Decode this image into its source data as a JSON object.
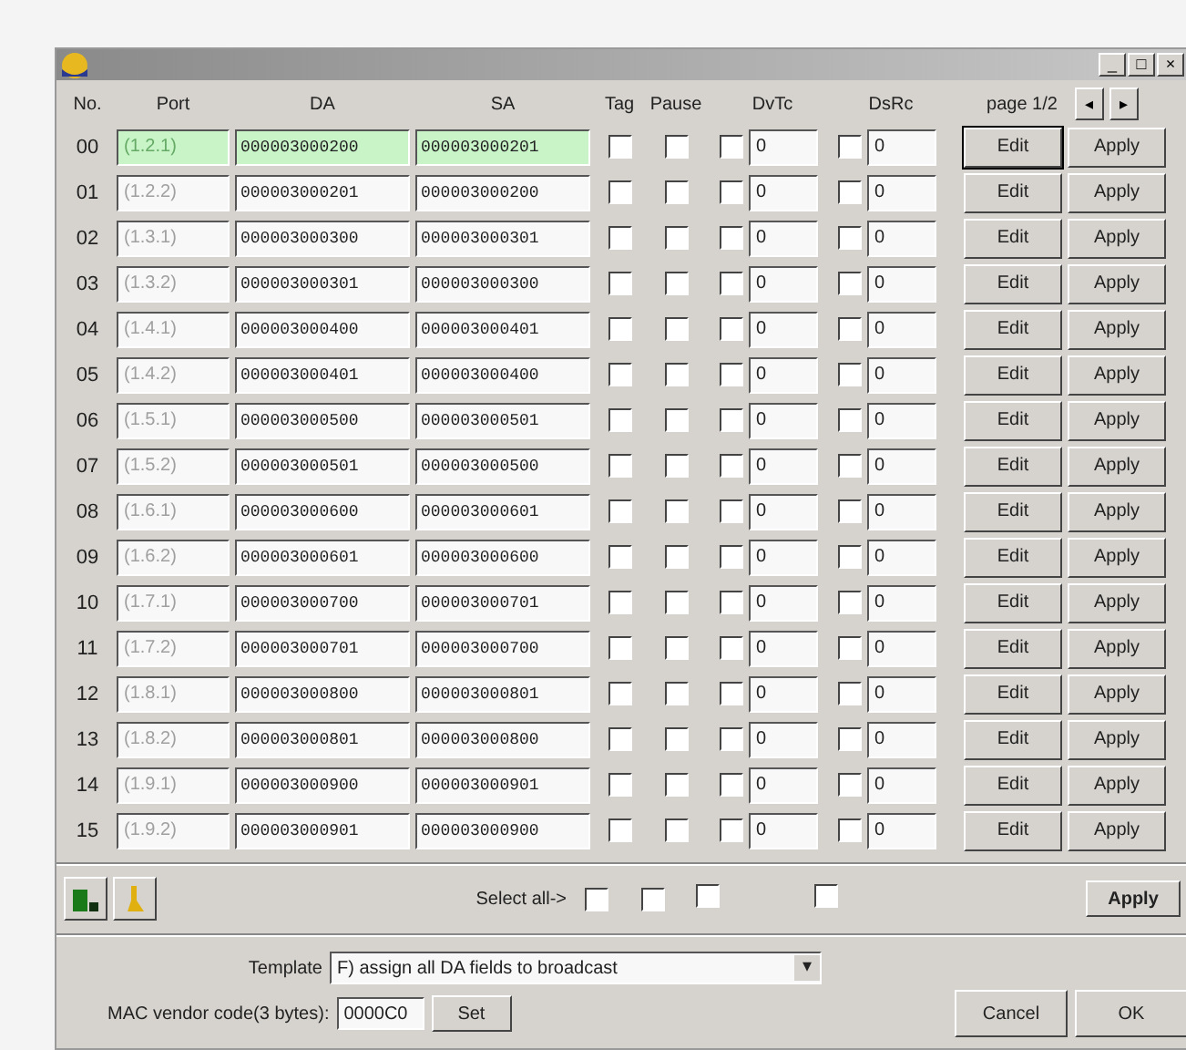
{
  "window": {
    "buttons": [
      "_",
      "□",
      "×"
    ]
  },
  "header": {
    "columns": [
      "No.",
      "Port",
      "DA",
      "SA",
      "Tag",
      "Pause",
      "DvTc",
      "DsRc"
    ],
    "page": "page 1/2",
    "nav": [
      "◂",
      "▸"
    ]
  },
  "rows": [
    {
      "no": "00",
      "port": "(1.2.1)",
      "da": "000003000200",
      "sa": "000003000201",
      "tag": false,
      "pause": false,
      "dv_checked": false,
      "dv": "0",
      "ds_checked": false,
      "ds": "0",
      "selected": true,
      "edit": "Edit",
      "apply": "Apply"
    },
    {
      "no": "01",
      "port": "(1.2.2)",
      "da": "000003000201",
      "sa": "000003000200",
      "tag": false,
      "pause": false,
      "dv_checked": false,
      "dv": "0",
      "ds_checked": false,
      "ds": "0",
      "selected": false,
      "edit": "Edit",
      "apply": "Apply"
    },
    {
      "no": "02",
      "port": "(1.3.1)",
      "da": "000003000300",
      "sa": "000003000301",
      "tag": false,
      "pause": false,
      "dv_checked": false,
      "dv": "0",
      "ds_checked": false,
      "ds": "0",
      "selected": false,
      "edit": "Edit",
      "apply": "Apply"
    },
    {
      "no": "03",
      "port": "(1.3.2)",
      "da": "000003000301",
      "sa": "000003000300",
      "tag": false,
      "pause": false,
      "dv_checked": false,
      "dv": "0",
      "ds_checked": false,
      "ds": "0",
      "selected": false,
      "edit": "Edit",
      "apply": "Apply"
    },
    {
      "no": "04",
      "port": "(1.4.1)",
      "da": "000003000400",
      "sa": "000003000401",
      "tag": false,
      "pause": false,
      "dv_checked": false,
      "dv": "0",
      "ds_checked": false,
      "ds": "0",
      "selected": false,
      "edit": "Edit",
      "apply": "Apply"
    },
    {
      "no": "05",
      "port": "(1.4.2)",
      "da": "000003000401",
      "sa": "000003000400",
      "tag": false,
      "pause": false,
      "dv_checked": false,
      "dv": "0",
      "ds_checked": false,
      "ds": "0",
      "selected": false,
      "edit": "Edit",
      "apply": "Apply"
    },
    {
      "no": "06",
      "port": "(1.5.1)",
      "da": "000003000500",
      "sa": "000003000501",
      "tag": false,
      "pause": false,
      "dv_checked": false,
      "dv": "0",
      "ds_checked": false,
      "ds": "0",
      "selected": false,
      "edit": "Edit",
      "apply": "Apply"
    },
    {
      "no": "07",
      "port": "(1.5.2)",
      "da": "000003000501",
      "sa": "000003000500",
      "tag": false,
      "pause": false,
      "dv_checked": false,
      "dv": "0",
      "ds_checked": false,
      "ds": "0",
      "selected": false,
      "edit": "Edit",
      "apply": "Apply"
    },
    {
      "no": "08",
      "port": "(1.6.1)",
      "da": "000003000600",
      "sa": "000003000601",
      "tag": false,
      "pause": false,
      "dv_checked": false,
      "dv": "0",
      "ds_checked": false,
      "ds": "0",
      "selected": false,
      "edit": "Edit",
      "apply": "Apply"
    },
    {
      "no": "09",
      "port": "(1.6.2)",
      "da": "000003000601",
      "sa": "000003000600",
      "tag": false,
      "pause": false,
      "dv_checked": false,
      "dv": "0",
      "ds_checked": false,
      "ds": "0",
      "selected": false,
      "edit": "Edit",
      "apply": "Apply"
    },
    {
      "no": "10",
      "port": "(1.7.1)",
      "da": "000003000700",
      "sa": "000003000701",
      "tag": false,
      "pause": false,
      "dv_checked": false,
      "dv": "0",
      "ds_checked": false,
      "ds": "0",
      "selected": false,
      "edit": "Edit",
      "apply": "Apply"
    },
    {
      "no": "11",
      "port": "(1.7.2)",
      "da": "000003000701",
      "sa": "000003000700",
      "tag": false,
      "pause": false,
      "dv_checked": false,
      "dv": "0",
      "ds_checked": false,
      "ds": "0",
      "selected": false,
      "edit": "Edit",
      "apply": "Apply"
    },
    {
      "no": "12",
      "port": "(1.8.1)",
      "da": "000003000800",
      "sa": "000003000801",
      "tag": false,
      "pause": false,
      "dv_checked": false,
      "dv": "0",
      "ds_checked": false,
      "ds": "0",
      "selected": false,
      "edit": "Edit",
      "apply": "Apply"
    },
    {
      "no": "13",
      "port": "(1.8.2)",
      "da": "000003000801",
      "sa": "000003000800",
      "tag": false,
      "pause": false,
      "dv_checked": false,
      "dv": "0",
      "ds_checked": false,
      "ds": "0",
      "selected": false,
      "edit": "Edit",
      "apply": "Apply"
    },
    {
      "no": "14",
      "port": "(1.9.1)",
      "da": "000003000900",
      "sa": "000003000901",
      "tag": false,
      "pause": false,
      "dv_checked": false,
      "dv": "0",
      "ds_checked": false,
      "ds": "0",
      "selected": false,
      "edit": "Edit",
      "apply": "Apply"
    },
    {
      "no": "15",
      "port": "(1.9.2)",
      "da": "000003000901",
      "sa": "000003000900",
      "tag": false,
      "pause": false,
      "dv_checked": false,
      "dv": "0",
      "ds_checked": false,
      "ds": "0",
      "selected": false,
      "edit": "Edit",
      "apply": "Apply"
    }
  ],
  "select_all": {
    "label": "Select all->",
    "tag": false,
    "pause": false,
    "dv": false,
    "ds": false,
    "apply": "Apply"
  },
  "template": {
    "label": "Template",
    "value": "F) assign all DA fields to broadcast",
    "arrow": "▾"
  },
  "mac": {
    "label": "MAC vendor code(3 bytes):",
    "value": "0000C0",
    "set": "Set"
  },
  "buttons": [
    "Cancel",
    "OK"
  ]
}
